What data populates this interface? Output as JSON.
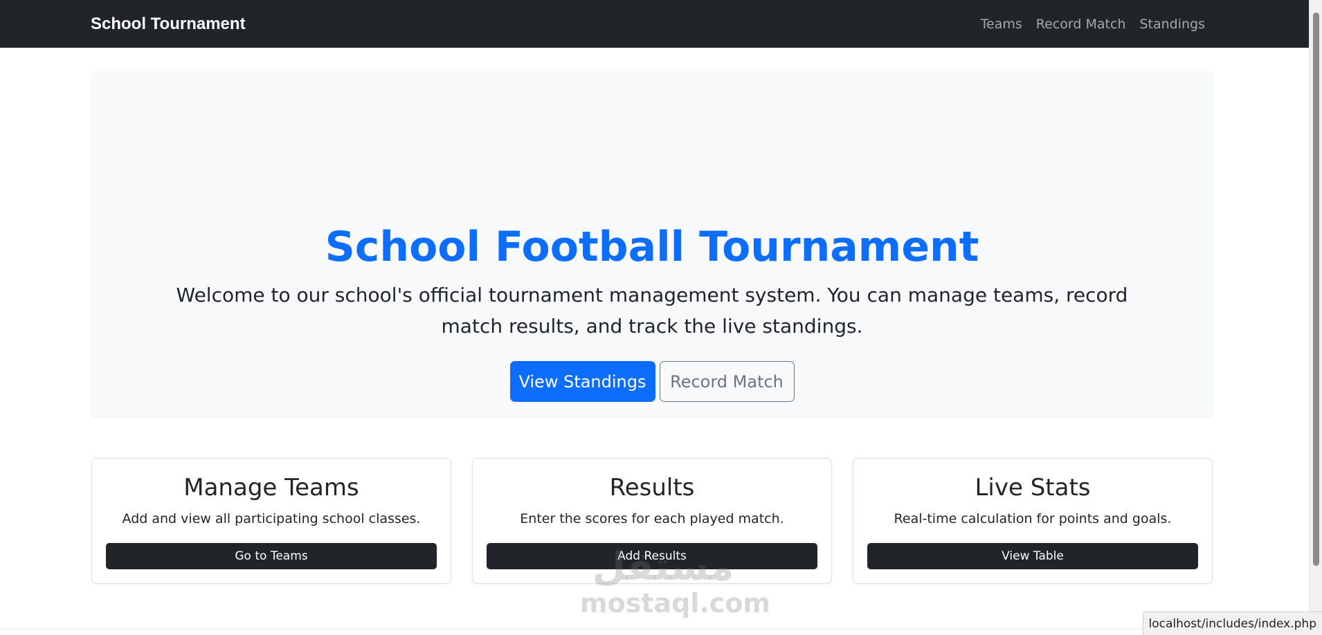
{
  "navbar": {
    "brand": "School Tournament",
    "links": [
      "Teams",
      "Record Match",
      "Standings"
    ],
    "background": "#212529"
  },
  "hero": {
    "title": "School Football Tournament",
    "text": "Welcome to our school's official tournament management system. You can manage teams, record match results, and track the live standings.",
    "primary_button": "View Standings",
    "secondary_button": "Record Match",
    "accent": "#0d6efd"
  },
  "cards": [
    {
      "title": "Manage Teams",
      "text": "Add and view all participating school classes.",
      "button": "Go to Teams"
    },
    {
      "title": "Results",
      "text": "Enter the scores for each played match.",
      "button": "Add Results"
    },
    {
      "title": "Live Stats",
      "text": "Real-time calculation for points and goals.",
      "button": "View Table"
    }
  ],
  "watermark": {
    "arabic": "مستقل",
    "latin": "mostaql.com"
  },
  "status_url": "localhost/includes/index.php"
}
